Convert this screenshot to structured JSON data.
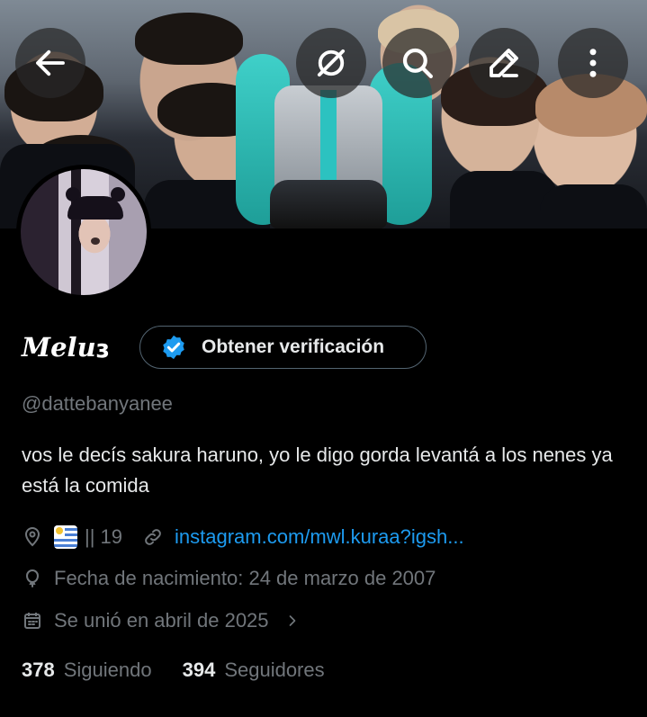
{
  "profile": {
    "display_name": "Melu",
    "name_emoji": "ɛ",
    "verify_label": "Obtener verificación",
    "handle": "@dattebanyanee",
    "bio": "vos le decís sakura haruno, yo le digo gorda levantá a los nenes ya está la comida",
    "location": "|| 19",
    "location_flag": "Uruguay",
    "link_text": "instagram.com/mwl.kuraa?igsh...",
    "birthday": "Fecha de nacimiento: 24 de marzo de 2007",
    "joined": "Se unió en abril de 2025",
    "following_count": "378",
    "following_label": "Siguiendo",
    "followers_count": "394",
    "followers_label": "Seguidores"
  },
  "toolbar": {
    "icons": [
      "back-arrow-icon",
      "grok-icon",
      "search-icon",
      "edit-icon",
      "more-icon"
    ]
  },
  "colors": {
    "background": "#000000",
    "text": "#e7e9ea",
    "muted": "#71767b",
    "link": "#1d9bf0",
    "verify_badge": "#1d9bf0"
  }
}
